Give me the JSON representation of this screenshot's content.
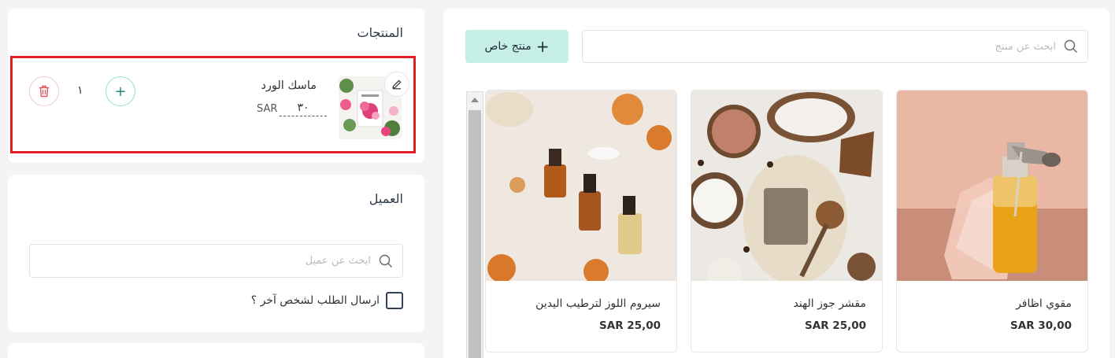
{
  "cart": {
    "title": "المنتجات",
    "item": {
      "name": "ماسك الورد",
      "price": "٣٠",
      "currency": "SAR",
      "quantity": "١"
    }
  },
  "customer": {
    "title": "العميل",
    "search_placeholder": "ابحث عن عميل",
    "send_to_other_label": "ارسال الطلب لشخص آخر ؟"
  },
  "catalog": {
    "search_placeholder": "ابحث عن منتج",
    "custom_product_label": "منتج خاص",
    "products": [
      {
        "name": "مقوي اظافر",
        "price": "SAR 30,00"
      },
      {
        "name": "مقشر جوز الهند",
        "price": "SAR 25,00"
      },
      {
        "name": "سيروم اللوز لترطيب اليدين",
        "price": "SAR 25,00"
      }
    ]
  },
  "colors": {
    "highlight": "#e21f26",
    "accent_mint": "#c6f0e6",
    "plus_teal": "#1b8f7a",
    "trash_red": "#e0525c"
  },
  "icons": [
    "pencil-icon",
    "plus-icon",
    "trash-icon",
    "search-icon"
  ]
}
